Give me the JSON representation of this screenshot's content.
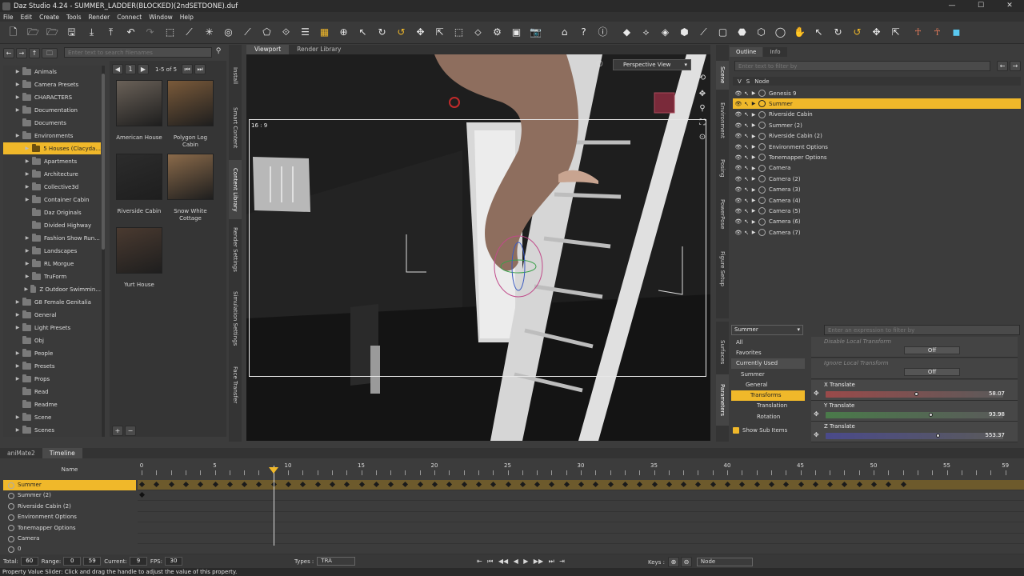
{
  "window": {
    "title": "Daz Studio 4.24 - SUMMER_LADDER(BLOCKED)(2ndSETDONE).duf",
    "controls": [
      "—",
      "☐",
      "✕"
    ]
  },
  "menu": [
    "File",
    "Edit",
    "Create",
    "Tools",
    "Render",
    "Connect",
    "Window",
    "Help"
  ],
  "content_library": {
    "search_placeholder": "Enter text to search filenames",
    "page_number": "1",
    "page_counter": "1-5 of 5",
    "tree": [
      {
        "label": "Animals",
        "indent": 1,
        "expander": true
      },
      {
        "label": "Camera Presets",
        "indent": 1,
        "expander": true
      },
      {
        "label": "CHARACTERS",
        "indent": 1,
        "expander": true
      },
      {
        "label": "Documentation",
        "indent": 1,
        "expander": true
      },
      {
        "label": "Documents",
        "indent": 1,
        "expander": false
      },
      {
        "label": "Environments",
        "indent": 1,
        "expander": true
      },
      {
        "label": "5 Houses (Clacyda...",
        "indent": 2,
        "expander": true,
        "selected": true
      },
      {
        "label": "Apartments",
        "indent": 2,
        "expander": true
      },
      {
        "label": "Architecture",
        "indent": 2,
        "expander": true
      },
      {
        "label": "Collective3d",
        "indent": 2,
        "expander": true
      },
      {
        "label": "Container Cabin",
        "indent": 2,
        "expander": true
      },
      {
        "label": "Daz Originals",
        "indent": 2,
        "expander": false
      },
      {
        "label": "Divided Highway",
        "indent": 2,
        "expander": false
      },
      {
        "label": "Fashion Show Run...",
        "indent": 2,
        "expander": true
      },
      {
        "label": "Landscapes",
        "indent": 2,
        "expander": true
      },
      {
        "label": "RL Morgue",
        "indent": 2,
        "expander": true
      },
      {
        "label": "TruForm",
        "indent": 2,
        "expander": true
      },
      {
        "label": "Z Outdoor Swimmin...",
        "indent": 2,
        "expander": true
      },
      {
        "label": "G8 Female Genitalia",
        "indent": 1,
        "expander": true
      },
      {
        "label": "General",
        "indent": 1,
        "expander": true
      },
      {
        "label": "Light Presets",
        "indent": 1,
        "expander": true
      },
      {
        "label": "Obj",
        "indent": 1,
        "expander": false
      },
      {
        "label": "People",
        "indent": 1,
        "expander": true
      },
      {
        "label": "Presets",
        "indent": 1,
        "expander": true
      },
      {
        "label": "Props",
        "indent": 1,
        "expander": true
      },
      {
        "label": "Read",
        "indent": 1,
        "expander": false
      },
      {
        "label": "Readme",
        "indent": 1,
        "expander": false
      },
      {
        "label": "Scene",
        "indent": 1,
        "expander": true
      },
      {
        "label": "Scenes",
        "indent": 1,
        "expander": true
      }
    ],
    "thumbnails": [
      {
        "label": "American House",
        "color": "#6a6158"
      },
      {
        "label": "Polygon Log Cabin",
        "color": "#7a5a3a"
      },
      {
        "label": "Riverside Cabin",
        "color": "#2c2c2c"
      },
      {
        "label": "Snow White Cottage",
        "color": "#8a6a4a"
      },
      {
        "label": "Yurt House",
        "color": "#4a3a30"
      }
    ]
  },
  "side_tabs_left": [
    "Install",
    "Smart Content",
    "Content Library",
    "Render Settings",
    "Simulation Settings",
    "Face Transfer"
  ],
  "viewport": {
    "tabs": [
      "Viewport",
      "Render Library"
    ],
    "camera": "Perspective View",
    "aspect_label": "16 : 9"
  },
  "side_tabs_right": [
    "Scene",
    "Environment",
    "Posing",
    "PowerPose",
    "Figure Setup"
  ],
  "side_tabs_params": [
    "Surfaces",
    "Parameters"
  ],
  "scene": {
    "tabs": [
      "Outline",
      "Info"
    ],
    "filter_placeholder": "Enter text to filter by",
    "header": [
      "V",
      "S",
      "Node"
    ],
    "nodes": [
      {
        "label": "Genesis 9",
        "selected": false
      },
      {
        "label": "Summer",
        "selected": true
      },
      {
        "label": "Riverside Cabin",
        "selected": false
      },
      {
        "label": "Summer (2)",
        "selected": false
      },
      {
        "label": "Riverside Cabin (2)",
        "selected": false
      },
      {
        "label": "Environment Options",
        "selected": false
      },
      {
        "label": "Tonemapper Options",
        "selected": false
      },
      {
        "label": "Camera",
        "selected": false
      },
      {
        "label": "Camera (2)",
        "selected": false
      },
      {
        "label": "Camera (3)",
        "selected": false
      },
      {
        "label": "Camera (4)",
        "selected": false
      },
      {
        "label": "Camera (5)",
        "selected": false
      },
      {
        "label": "Camera (6)",
        "selected": false
      },
      {
        "label": "Camera (7)",
        "selected": false
      }
    ]
  },
  "parameters": {
    "node_select": "Summer",
    "filter_placeholder": "Enter an expression to filter by",
    "categories": [
      "All",
      "Favorites",
      "Currently Used",
      "Summer",
      "General",
      "Transforms",
      "Translation",
      "Rotation"
    ],
    "show_sub_items": "Show Sub Items",
    "properties": [
      {
        "label": "Disable Local Transform",
        "value": "Off"
      },
      {
        "label": "Ignore Local Transform",
        "value": "Off"
      }
    ],
    "sliders": [
      {
        "label": "X Translate",
        "value": "58.07",
        "color": "#9a4a4a",
        "level": 0.5
      },
      {
        "label": "Y Translate",
        "value": "93.98",
        "color": "#4a7a4a",
        "level": 0.58
      },
      {
        "label": "Z Translate",
        "value": "553.37",
        "color": "#4a4a8a",
        "level": 0.62
      }
    ]
  },
  "timeline": {
    "tabs": [
      "aniMate2",
      "Timeline"
    ],
    "name_header": "Name",
    "rows": [
      {
        "label": "Summer",
        "selected": true
      },
      {
        "label": "Summer (2)",
        "selected": false
      },
      {
        "label": "Riverside Cabin (2)",
        "selected": false
      },
      {
        "label": "Environment Options",
        "selected": false
      },
      {
        "label": "Tonemapper Options",
        "selected": false
      },
      {
        "label": "Camera",
        "selected": false
      },
      {
        "label": "0",
        "selected": false
      }
    ],
    "ticks": [
      "0",
      "5",
      "10",
      "15",
      "20",
      "25",
      "30",
      "35",
      "40",
      "45",
      "50",
      "55"
    ],
    "last_tick": "59",
    "total_label": "Total:",
    "total": "60",
    "range_label": "Range:",
    "range_start": "0",
    "range_end": "59",
    "current_label": "Current:",
    "current": "9",
    "fps_label": "FPS:",
    "fps": "30",
    "types_label": "Types :",
    "types_value": "TRA",
    "keys_label": "Keys :",
    "keys_value": "Node",
    "playback": [
      "⇤",
      "⏮",
      "◀◀",
      "◀",
      "▶",
      "▶▶",
      "⏭",
      "⇥"
    ]
  },
  "status": "Property Value Slider: Click and drag the handle to adjust the value of this property.",
  "colors": {
    "accent": "#f0b82a",
    "panel": "#3c3c3c",
    "viewport": "#1b1b1b"
  }
}
